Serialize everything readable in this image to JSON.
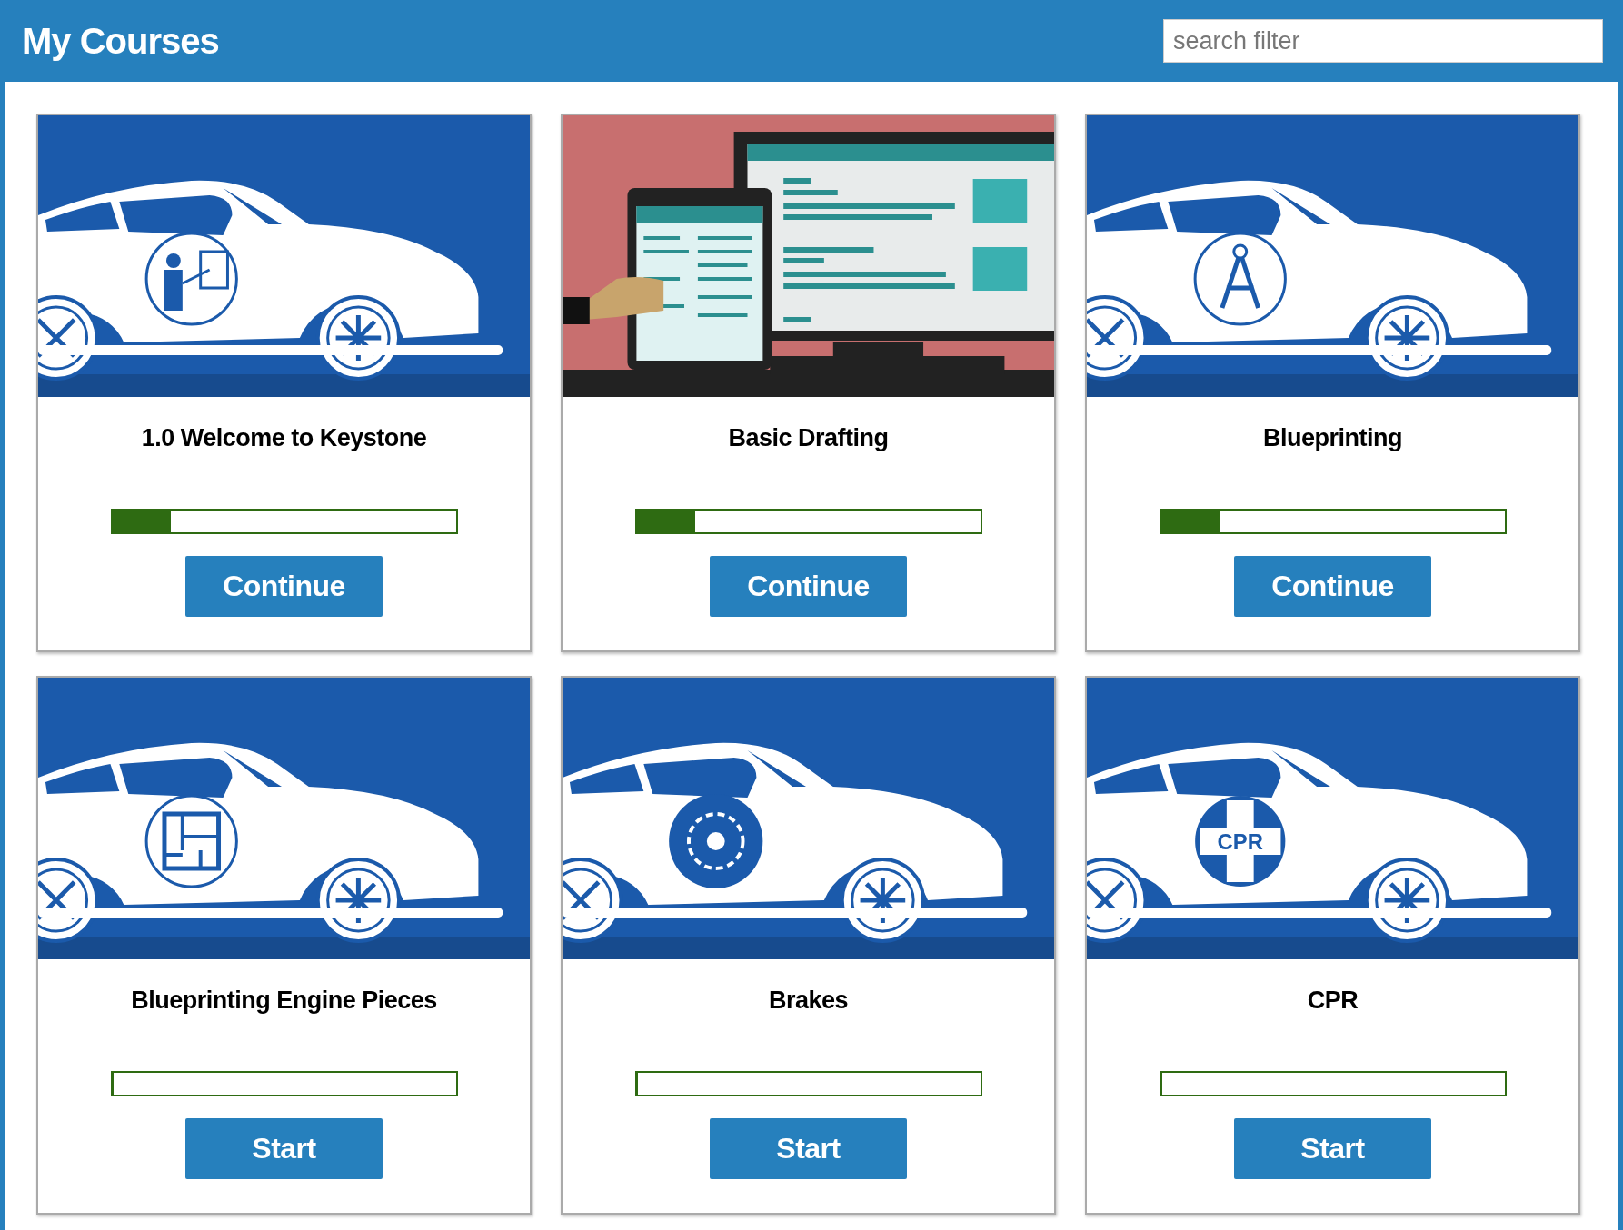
{
  "header": {
    "title": "My Courses",
    "search": {
      "placeholder": "search filter"
    }
  },
  "courses": [
    {
      "title": "1.0 Welcome to Keystone",
      "image": {
        "kind": "car",
        "emblem": {
          "kind": "presenter"
        }
      },
      "level": 0.17,
      "action": "Continue"
    },
    {
      "title": "Basic Drafting",
      "image": {
        "kind": "screens"
      },
      "level": 0.17,
      "action": "Continue"
    },
    {
      "title": "Blueprinting",
      "image": {
        "kind": "car",
        "emblem": {
          "kind": "compass"
        }
      },
      "level": 0.17,
      "action": "Continue"
    },
    {
      "title": "Blueprinting Engine Pieces",
      "image": {
        "kind": "car",
        "emblem": {
          "kind": "floor-plan"
        }
      },
      "level": 0,
      "action": "Start"
    },
    {
      "title": "Brakes",
      "image": {
        "kind": "car",
        "emblem": {
          "kind": "brake-disc"
        }
      },
      "level": 0,
      "action": "Start"
    },
    {
      "title": "CPR",
      "image": {
        "kind": "car",
        "emblem": {
          "kind": "cross",
          "text": "CPR"
        }
      },
      "level": 0,
      "action": "Start"
    }
  ]
}
